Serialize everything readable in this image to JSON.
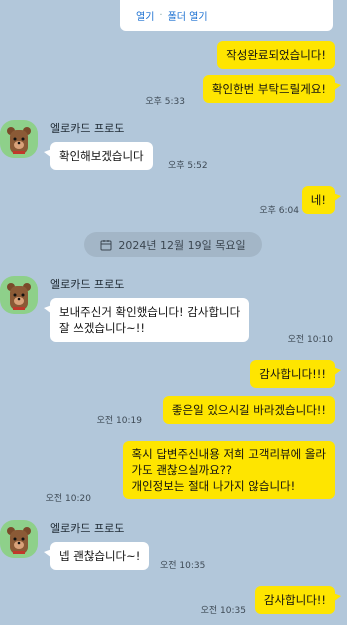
{
  "file_card": {
    "open_label": "열기",
    "separator": "·",
    "open_folder_label": "폴더 열기"
  },
  "date_divider": "2024년 12월 19일 목요일",
  "sender_name": "엘로카드 프로도",
  "messages": {
    "m1": {
      "text": "작성완료되었습니다!"
    },
    "m2": {
      "text": "확인한번 부탁드릴게요!",
      "time": "오후 5:33"
    },
    "m3": {
      "text": "확인해보겠습니다",
      "time": "오후 5:52"
    },
    "m4": {
      "text": "네!",
      "time": "오후 6:04"
    },
    "m5": {
      "line1": "보내주신거 확인했습니다! 감사합니다",
      "line2": "잘 쓰겠습니다~!!",
      "time": "오전 10:10"
    },
    "m6": {
      "text": "감사합니다!!!"
    },
    "m7": {
      "text": "좋은일 있으시길 바라겠습니다!!",
      "time": "오전 10:19"
    },
    "m8": {
      "line1": "혹시 답변주신내용 저희 고객리뷰에 올라",
      "line2": "가도 괜찮으실까요??",
      "line3": "개인정보는 절대 나가지 않습니다!",
      "time": "오전 10:20"
    },
    "m9": {
      "text": "넵 괜찮습니다~!",
      "time": "오전 10:35"
    },
    "m10": {
      "text": "감사합니다!!",
      "time": "오전 10:35"
    }
  },
  "colors": {
    "background": "#b2c7da",
    "my_bubble": "#fee500",
    "their_bubble": "#ffffff",
    "avatar_bg": "#8ed08a"
  },
  "icons": {
    "calendar": "calendar-icon",
    "avatar": "bear-avatar-icon"
  }
}
